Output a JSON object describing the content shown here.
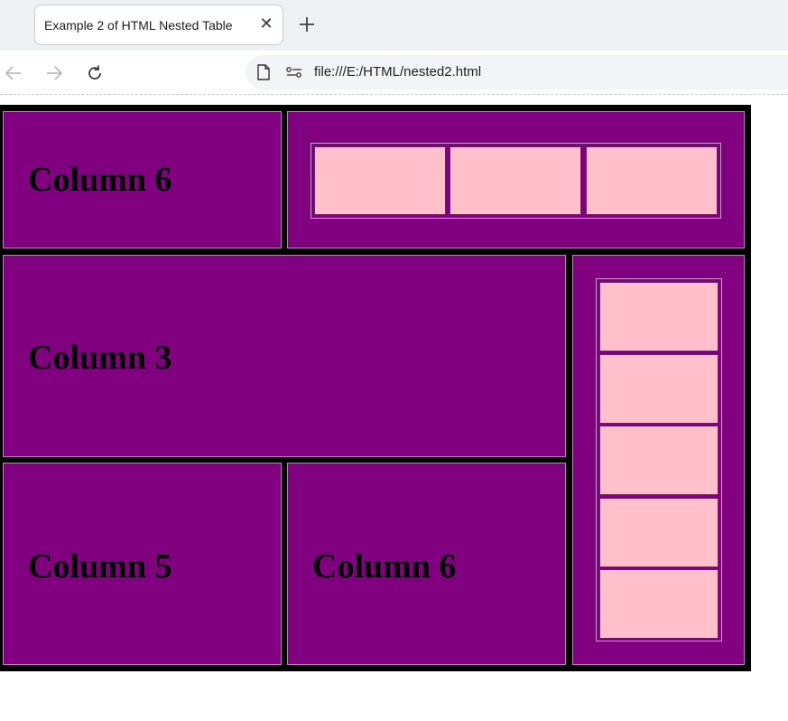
{
  "browser": {
    "tab_title": "Example 2 of HTML Nested Table",
    "url": "file:///E:/HTML/nested2.html"
  },
  "colors": {
    "outer_border": "#000000",
    "cell_background": "#800080",
    "inner_cell_background": "#ffc0cb",
    "label_color": "#000000"
  },
  "table": {
    "row1_col1_label": "Column 6",
    "row2_label": "Column 3",
    "row3_col1_label": "Column 5",
    "row3_col2_label": "Column 6",
    "horizontal_inner_cells": 3,
    "vertical_inner_cells": 5
  }
}
